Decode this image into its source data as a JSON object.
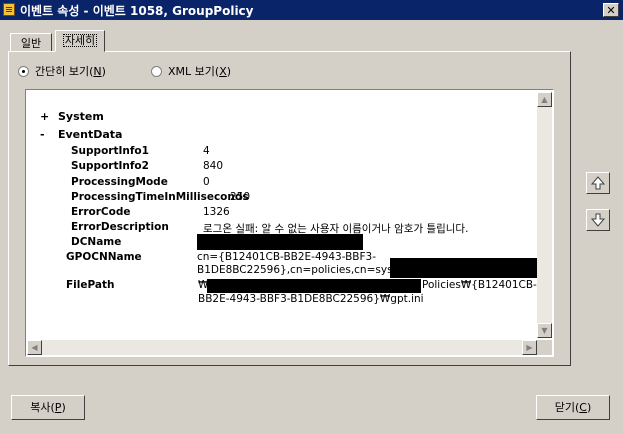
{
  "window": {
    "title": "이벤트 속성 - 이벤트 1058, GroupPolicy",
    "close_glyph": "✕"
  },
  "tabs": [
    {
      "label": "일반"
    },
    {
      "label": "자세히"
    }
  ],
  "view_options": {
    "simple": {
      "label": "간단히 보기(",
      "accel": "N",
      "suffix": ")",
      "selected": true
    },
    "xml": {
      "label": "XML 보기(",
      "accel": "X",
      "suffix": ")",
      "selected": false
    }
  },
  "tree": {
    "system": {
      "toggle": "+",
      "label": "System"
    },
    "eventdata": {
      "toggle": "-",
      "label": "EventData"
    },
    "fields": [
      {
        "key": "SupportInfo1",
        "value": "4"
      },
      {
        "key": "SupportInfo2",
        "value": "840"
      },
      {
        "key": "ProcessingMode",
        "value": "0"
      },
      {
        "key": "ProcessingTimeInMilliseconds",
        "value": "250"
      },
      {
        "key": "ErrorCode",
        "value": "1326"
      },
      {
        "key": "ErrorDescription",
        "value": "로그온 실패: 알 수 없는 사용자 이름이거나 암호가 틀립니다."
      },
      {
        "key": "DCName",
        "value": ""
      }
    ],
    "gpocn": {
      "key": "GPOCNName",
      "line1": "cn={B12401CB-BB2E-4943-BBF3-",
      "line2": "B1DE8BC22596},cn=policies,cn=system"
    },
    "filepath": {
      "key": "FilePath",
      "line1_prefix": "₩",
      "line1_suffix": "Policies₩{B12401CB-",
      "line2": "BB2E-4943-BBF3-B1DE8BC22596}₩gpt.ini"
    }
  },
  "buttons": {
    "copy": {
      "label": "복사(",
      "accel": "P",
      "suffix": ")"
    },
    "close": {
      "label": "닫기(",
      "accel": "C",
      "suffix": ")"
    }
  },
  "icons": {
    "up": "arrow-up-icon",
    "down": "arrow-down-icon"
  },
  "colors": {
    "titlebar": "#0a246a",
    "face": "#d4d0c8"
  }
}
